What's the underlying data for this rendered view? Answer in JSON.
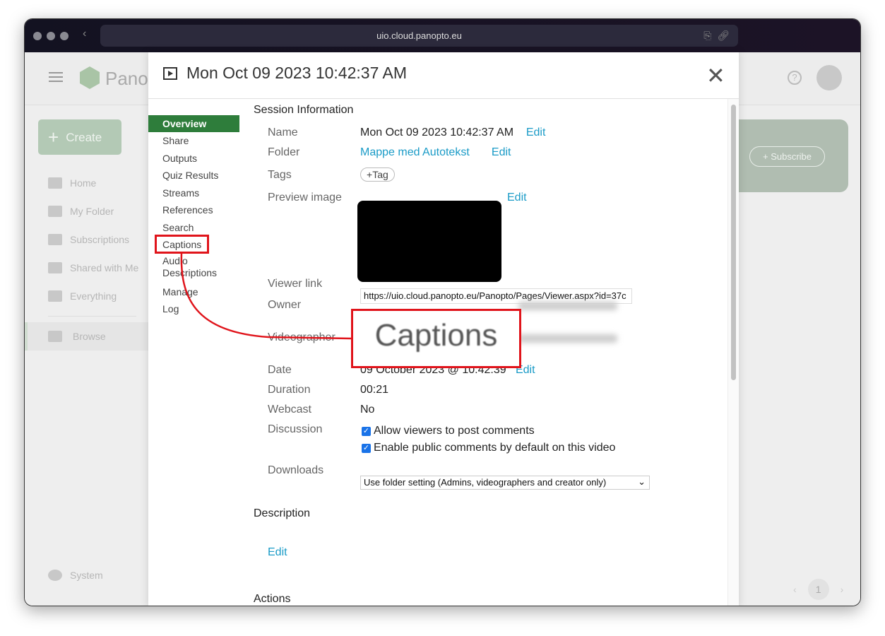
{
  "browser": {
    "url": "uio.cloud.panopto.eu"
  },
  "app": {
    "brand": "Panopto",
    "create_label": "Create",
    "subscribe_label": "Subscribe",
    "page_number": "1",
    "sidebar": [
      {
        "label": "Home"
      },
      {
        "label": "My Folder"
      },
      {
        "label": "Subscriptions"
      },
      {
        "label": "Shared with Me"
      },
      {
        "label": "Everything"
      }
    ],
    "browse_label": "Browse",
    "system_label": "System"
  },
  "modal": {
    "title": "Mon Oct 09 2023 10:42:37 AM",
    "nav": [
      {
        "label": "Overview",
        "active": true
      },
      {
        "label": "Share"
      },
      {
        "label": "Outputs"
      },
      {
        "label": "Quiz Results"
      },
      {
        "label": "Streams"
      },
      {
        "label": "References"
      },
      {
        "label": "Search"
      },
      {
        "label": "Captions"
      },
      {
        "label": "Audio Descriptions"
      },
      {
        "label": "Manage"
      },
      {
        "label": "Log"
      }
    ],
    "session_heading": "Session Information",
    "fields": {
      "name": {
        "label": "Name",
        "value": "Mon Oct 09 2023 10:42:37 AM",
        "edit": "Edit"
      },
      "folder": {
        "label": "Folder",
        "value": "Mappe med Autotekst",
        "edit": "Edit"
      },
      "tags": {
        "label": "Tags",
        "button": "Tag"
      },
      "preview": {
        "label": "Preview image",
        "edit": "Edit"
      },
      "viewer_link": {
        "label": "Viewer link",
        "value": "https://uio.cloud.panopto.eu/Panopto/Pages/Viewer.aspx?id=37c"
      },
      "owner": {
        "label": "Owner"
      },
      "videographer": {
        "label": "Videographer"
      },
      "date": {
        "label": "Date",
        "value": "09 October 2023 @ 10:42:39",
        "edit": "Edit"
      },
      "duration": {
        "label": "Duration",
        "value": "00:21"
      },
      "webcast": {
        "label": "Webcast",
        "value": "No"
      },
      "discussion": {
        "label": "Discussion",
        "option1": "Allow viewers to post comments",
        "option1_checked": true,
        "option2": "Enable public comments by default on this video",
        "option2_checked": true
      },
      "downloads": {
        "label": "Downloads",
        "selected": "Use folder setting (Admins, videographers and creator only)"
      }
    },
    "description_heading": "Description",
    "description_edit": "Edit",
    "actions_heading": "Actions"
  },
  "callout": {
    "text": "Captions",
    "color": "#e0141b"
  },
  "colors": {
    "accent": "#2e7d3b",
    "link": "#1a9bc7"
  }
}
